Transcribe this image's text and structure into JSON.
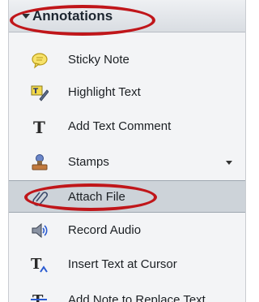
{
  "panel": {
    "title": "Annotations",
    "items": [
      {
        "label": "Sticky Note",
        "icon": "sticky-note-icon"
      },
      {
        "label": "Highlight Text",
        "icon": "highlight-text-icon"
      },
      {
        "label": "Add Text Comment",
        "icon": "text-comment-icon"
      },
      {
        "label": "Stamps",
        "icon": "stamp-icon"
      },
      {
        "label": "Attach File",
        "icon": "paperclip-icon"
      },
      {
        "label": "Record Audio",
        "icon": "speaker-icon"
      },
      {
        "label": "Insert Text at Cursor",
        "icon": "insert-text-icon"
      },
      {
        "label": "Add Note to Replace Text",
        "icon": "replace-text-icon"
      }
    ]
  },
  "colors": {
    "highlight_oval": "#c0161a",
    "selected_row": "#cdd3d9"
  }
}
